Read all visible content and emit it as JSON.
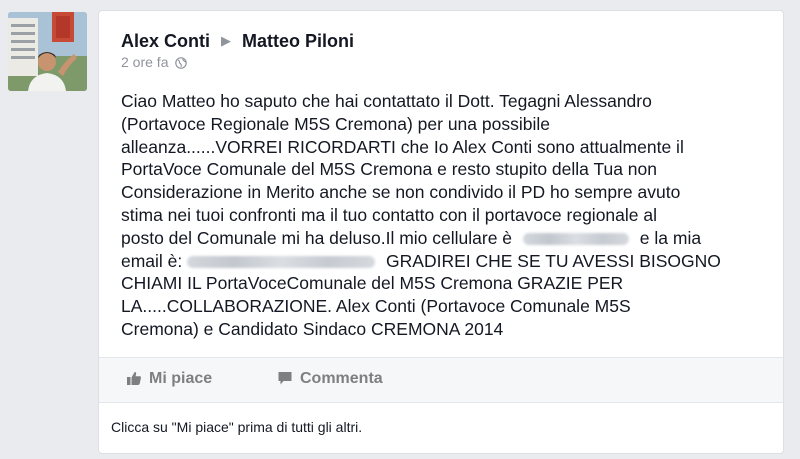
{
  "post": {
    "author": "Alex Conti",
    "recipient": "Matteo Piloni",
    "timestamp": "2 ore fa",
    "privacy_icon": "globe-icon",
    "lines": [
      "Ciao Matteo ho saputo che hai contattato il Dott. Tegagni Alessandro",
      "(Portavoce Regionale M5S Cremona) per una possibile",
      "alleanza......VORREI RICORDARTI che Io Alex Conti sono attualmente il",
      "PortaVoce Comunale del M5S Cremona e resto stupito della Tua non",
      "Considerazione in Merito anche se non condivido il PD ho sempre avuto",
      "stima nei tuoi confronti ma il tuo contatto con il portavoce regionale al",
      "posto del Comunale mi ha deluso.Il mio cellulare è",
      "e la mia",
      "email è:",
      "GRADIREI CHE SE TU AVESSI BISOGNO",
      "CHIAMI IL PortaVoceComunale del M5S Cremona GRAZIE PER",
      "LA.....COLLABORAZIONE. Alex Conti (Portavoce Comunale M5S",
      "Cremona) e Candidato Sindaco CREMONA 2014"
    ]
  },
  "actions": {
    "like_label": "Mi piace",
    "like_icon": "thumbs-up-icon",
    "comment_label": "Commenta",
    "comment_icon": "comment-icon"
  },
  "footer": {
    "like_prompt": "Clicca su \"Mi piace\" prima di tutti gli altri."
  }
}
